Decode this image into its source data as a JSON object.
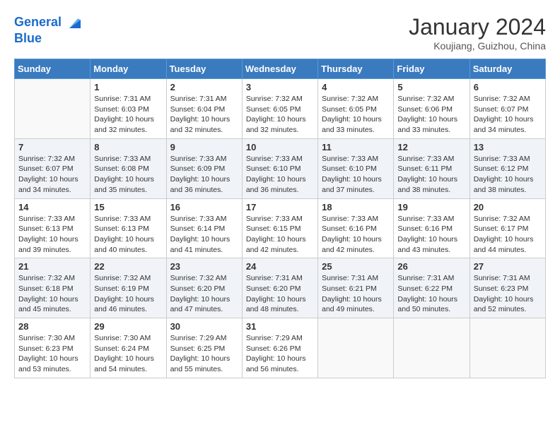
{
  "header": {
    "logo_line1": "General",
    "logo_line2": "Blue",
    "month": "January 2024",
    "location": "Koujiang, Guizhou, China"
  },
  "weekdays": [
    "Sunday",
    "Monday",
    "Tuesday",
    "Wednesday",
    "Thursday",
    "Friday",
    "Saturday"
  ],
  "weeks": [
    [
      {
        "day": "",
        "info": ""
      },
      {
        "day": "1",
        "info": "Sunrise: 7:31 AM\nSunset: 6:03 PM\nDaylight: 10 hours\nand 32 minutes."
      },
      {
        "day": "2",
        "info": "Sunrise: 7:31 AM\nSunset: 6:04 PM\nDaylight: 10 hours\nand 32 minutes."
      },
      {
        "day": "3",
        "info": "Sunrise: 7:32 AM\nSunset: 6:05 PM\nDaylight: 10 hours\nand 32 minutes."
      },
      {
        "day": "4",
        "info": "Sunrise: 7:32 AM\nSunset: 6:05 PM\nDaylight: 10 hours\nand 33 minutes."
      },
      {
        "day": "5",
        "info": "Sunrise: 7:32 AM\nSunset: 6:06 PM\nDaylight: 10 hours\nand 33 minutes."
      },
      {
        "day": "6",
        "info": "Sunrise: 7:32 AM\nSunset: 6:07 PM\nDaylight: 10 hours\nand 34 minutes."
      }
    ],
    [
      {
        "day": "7",
        "info": "Sunrise: 7:32 AM\nSunset: 6:07 PM\nDaylight: 10 hours\nand 34 minutes."
      },
      {
        "day": "8",
        "info": "Sunrise: 7:33 AM\nSunset: 6:08 PM\nDaylight: 10 hours\nand 35 minutes."
      },
      {
        "day": "9",
        "info": "Sunrise: 7:33 AM\nSunset: 6:09 PM\nDaylight: 10 hours\nand 36 minutes."
      },
      {
        "day": "10",
        "info": "Sunrise: 7:33 AM\nSunset: 6:10 PM\nDaylight: 10 hours\nand 36 minutes."
      },
      {
        "day": "11",
        "info": "Sunrise: 7:33 AM\nSunset: 6:10 PM\nDaylight: 10 hours\nand 37 minutes."
      },
      {
        "day": "12",
        "info": "Sunrise: 7:33 AM\nSunset: 6:11 PM\nDaylight: 10 hours\nand 38 minutes."
      },
      {
        "day": "13",
        "info": "Sunrise: 7:33 AM\nSunset: 6:12 PM\nDaylight: 10 hours\nand 38 minutes."
      }
    ],
    [
      {
        "day": "14",
        "info": "Sunrise: 7:33 AM\nSunset: 6:13 PM\nDaylight: 10 hours\nand 39 minutes."
      },
      {
        "day": "15",
        "info": "Sunrise: 7:33 AM\nSunset: 6:13 PM\nDaylight: 10 hours\nand 40 minutes."
      },
      {
        "day": "16",
        "info": "Sunrise: 7:33 AM\nSunset: 6:14 PM\nDaylight: 10 hours\nand 41 minutes."
      },
      {
        "day": "17",
        "info": "Sunrise: 7:33 AM\nSunset: 6:15 PM\nDaylight: 10 hours\nand 42 minutes."
      },
      {
        "day": "18",
        "info": "Sunrise: 7:33 AM\nSunset: 6:16 PM\nDaylight: 10 hours\nand 42 minutes."
      },
      {
        "day": "19",
        "info": "Sunrise: 7:33 AM\nSunset: 6:16 PM\nDaylight: 10 hours\nand 43 minutes."
      },
      {
        "day": "20",
        "info": "Sunrise: 7:32 AM\nSunset: 6:17 PM\nDaylight: 10 hours\nand 44 minutes."
      }
    ],
    [
      {
        "day": "21",
        "info": "Sunrise: 7:32 AM\nSunset: 6:18 PM\nDaylight: 10 hours\nand 45 minutes."
      },
      {
        "day": "22",
        "info": "Sunrise: 7:32 AM\nSunset: 6:19 PM\nDaylight: 10 hours\nand 46 minutes."
      },
      {
        "day": "23",
        "info": "Sunrise: 7:32 AM\nSunset: 6:20 PM\nDaylight: 10 hours\nand 47 minutes."
      },
      {
        "day": "24",
        "info": "Sunrise: 7:31 AM\nSunset: 6:20 PM\nDaylight: 10 hours\nand 48 minutes."
      },
      {
        "day": "25",
        "info": "Sunrise: 7:31 AM\nSunset: 6:21 PM\nDaylight: 10 hours\nand 49 minutes."
      },
      {
        "day": "26",
        "info": "Sunrise: 7:31 AM\nSunset: 6:22 PM\nDaylight: 10 hours\nand 50 minutes."
      },
      {
        "day": "27",
        "info": "Sunrise: 7:31 AM\nSunset: 6:23 PM\nDaylight: 10 hours\nand 52 minutes."
      }
    ],
    [
      {
        "day": "28",
        "info": "Sunrise: 7:30 AM\nSunset: 6:23 PM\nDaylight: 10 hours\nand 53 minutes."
      },
      {
        "day": "29",
        "info": "Sunrise: 7:30 AM\nSunset: 6:24 PM\nDaylight: 10 hours\nand 54 minutes."
      },
      {
        "day": "30",
        "info": "Sunrise: 7:29 AM\nSunset: 6:25 PM\nDaylight: 10 hours\nand 55 minutes."
      },
      {
        "day": "31",
        "info": "Sunrise: 7:29 AM\nSunset: 6:26 PM\nDaylight: 10 hours\nand 56 minutes."
      },
      {
        "day": "",
        "info": ""
      },
      {
        "day": "",
        "info": ""
      },
      {
        "day": "",
        "info": ""
      }
    ]
  ]
}
